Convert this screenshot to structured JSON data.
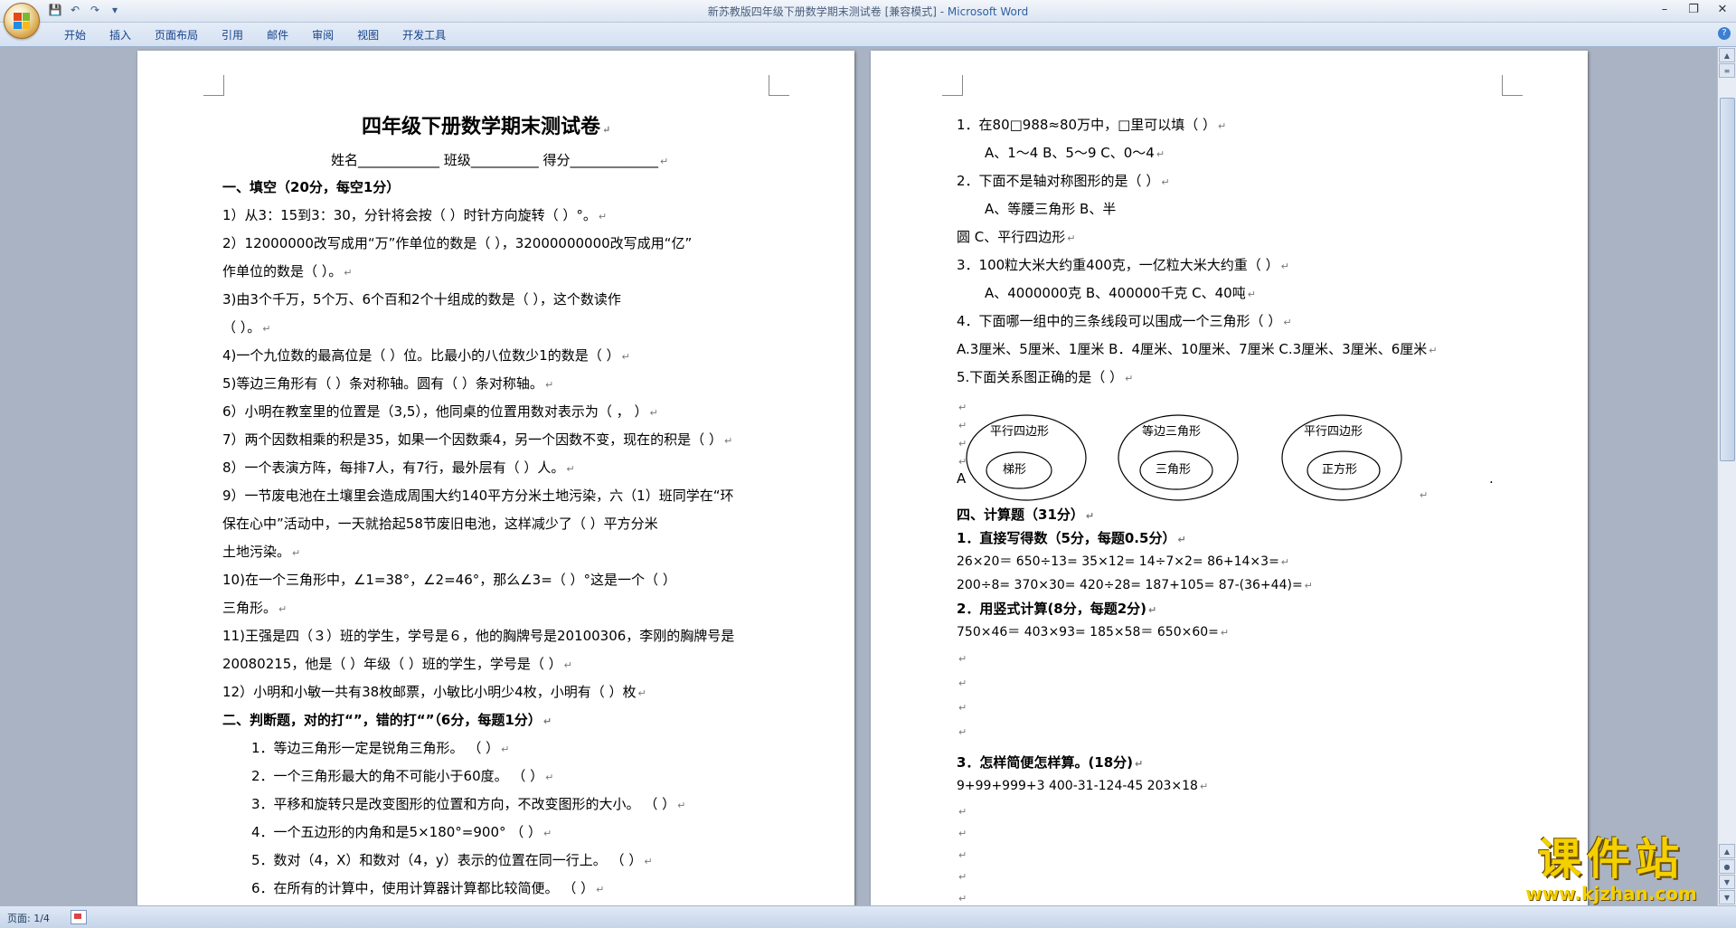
{
  "window": {
    "title": "新苏教版四年级下册数学期末测试卷 [兼容模式] - ",
    "app_name": "Microsoft Word",
    "controls": [
      "–",
      "❐",
      "✕"
    ]
  },
  "qat": [
    "💾",
    "↶",
    "↷",
    "▾"
  ],
  "ribbon": {
    "tabs": [
      "开始",
      "插入",
      "页面布局",
      "引用",
      "邮件",
      "审阅",
      "视图",
      "开发工具"
    ],
    "help": "?"
  },
  "status": {
    "page": "页面: 1/4"
  },
  "watermark": {
    "cn": "课件站",
    "url": "www.kjzhan.com"
  },
  "left_page": {
    "title": "四年级下册数学期末测试卷",
    "info": "姓名____________      班级__________      得分_____________",
    "lines": [
      "一、填空（20分，每空1分）",
      "1）从3：15到3：30，分针将会按（      ）时针方向旋转（        ）°。",
      "2）12000000改写成用“万”作单位的数是（            ），32000000000改写成用“亿”",
      "作单位的数是（            ）。",
      "3)由3个千万，5个万、6个百和2个十组成的数是（              ），这个数读作",
      "（                        ）。",
      "4)一个九位数的最高位是（       ）位。比最小的八位数少1的数是（             ）",
      "5)等边三角形有（       ）条对称轴。圆有（         ）条对称轴。",
      "6）小明在教室里的位置是（3,5），他同桌的位置用数对表示为（        ，      ）",
      "7）两个因数相乘的积是35，如果一个因数乘4，另一个因数不变，现在的积是（       ）",
      "8）一个表演方阵，每排7人，有7行，最外层有（           ）人。",
      "9）一节废电池在土壤里会造成周围大约140平方分米土地污染，六（1）班同学在“环",
      "保在心中”活动中，一天就拾起58节废旧电池，这样减少了（               ）平方分米",
      "土地污染。",
      "10)在一个三角形中，∠1=38°，∠2=46°，那么∠3=（         ）°这是一个（         ）",
      "三角形。",
      "11)王强是四（３）班的学生，学号是６，他的胸牌号是20100306，李刚的胸牌号是",
      "20080215，他是（        ）年级（        ）班的学生，学号是（         ）",
      "12）小明和小敏一共有38枚邮票，小敏比小明少4枚，小明有（         ）枚",
      "二、判断题，对的打“”，错的打“”（6分，每题1分）",
      "1．等边三角形一定是锐角三角形。                                  （      ）",
      "2．一个三角形最大的角不可能小于60度。                          （      ）",
      "3．平移和旋转只是改变图形的位置和方向，不改变图形的大小。   （      ）",
      "4．一个五边形的内角和是5×180°=900°                           （      ）",
      "5．数对（4，X）和数对（4，y）表示的位置在同一行上。          （      ）",
      "6．在所有的计算中，使用计算器计算都比较简便。                  （      ）"
    ]
  },
  "right_page": {
    "lines": [
      "1．在80□988≈80万中，□里可以填（          ）",
      "A、1～4                    B、5～9                    C、0～4",
      "2．下面不是轴对称图形的是（          ）",
      "A、等腰三角形                                                B、半",
      "圆                                                C、平行四边形",
      "3．100粒大米大约重400克，一亿粒大米大约重（          ）",
      "A、4000000克              B、400000千克           C、40吨",
      "4．下面哪一组中的三条线段可以围成一个三角形（          ）",
      "A.3厘米、5厘米、1厘米   B．4厘米、10厘米、7厘米    C.3厘米、3厘米、6厘米",
      "5.下面关系图正确的是（          ）",
      "四、计算题（31分）",
      "1．直接写得数（5分，每题0.5分）",
      "26×20＝            650÷13=           35×12=          14÷7×2=            86+14×3=",
      "200÷8=              370×30=            420÷28=         187+105=           87-(36+44)=",
      "2．用竖式计算(8分，每题2分)",
      "750×46＝              403×93=                    185×58＝               650×60=",
      "3．怎样简便怎样算。(18分)",
      "9+99+999+3                     400-31-124-45              203×18"
    ],
    "venn_label_a": "A",
    "venn_dot": ".",
    "venn": [
      {
        "outer": "平行四边形",
        "inner": "梯形"
      },
      {
        "outer": "等边三角形",
        "inner": "三角形"
      },
      {
        "outer": "平行四边形",
        "inner": "正方形"
      }
    ]
  },
  "colors": {
    "app_blue": "#2f5fa0",
    "tab_text": "#15428b",
    "watermark": "#f4d000"
  }
}
